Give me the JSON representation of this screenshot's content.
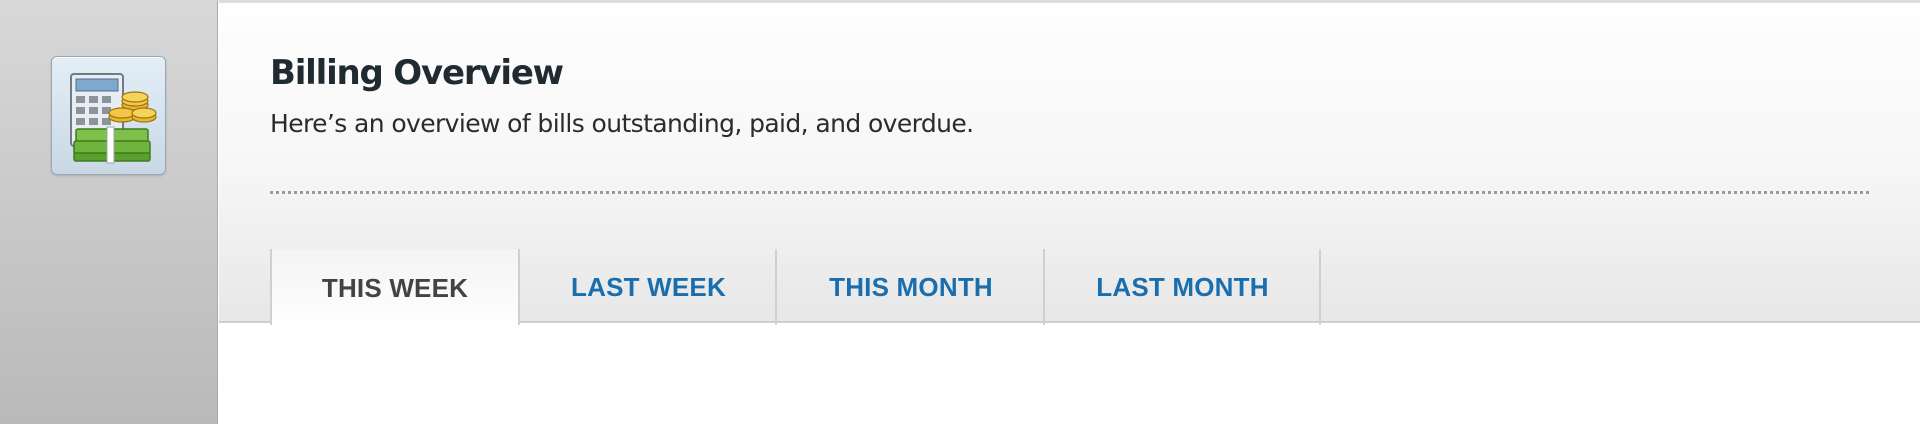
{
  "header": {
    "title": "Billing Overview",
    "subtitle": "Here’s an overview of bills outstanding, paid, and overdue."
  },
  "app_icon": {
    "name": "billing-calculator-money-icon"
  },
  "tabs": [
    {
      "label": "THIS WEEK",
      "active": true
    },
    {
      "label": "LAST WEEK",
      "active": false
    },
    {
      "label": "THIS MONTH",
      "active": false
    },
    {
      "label": "LAST MONTH",
      "active": false
    }
  ],
  "colors": {
    "tab_link": "#1a6eae",
    "tab_active": "#434343",
    "title": "#1f2a31"
  }
}
